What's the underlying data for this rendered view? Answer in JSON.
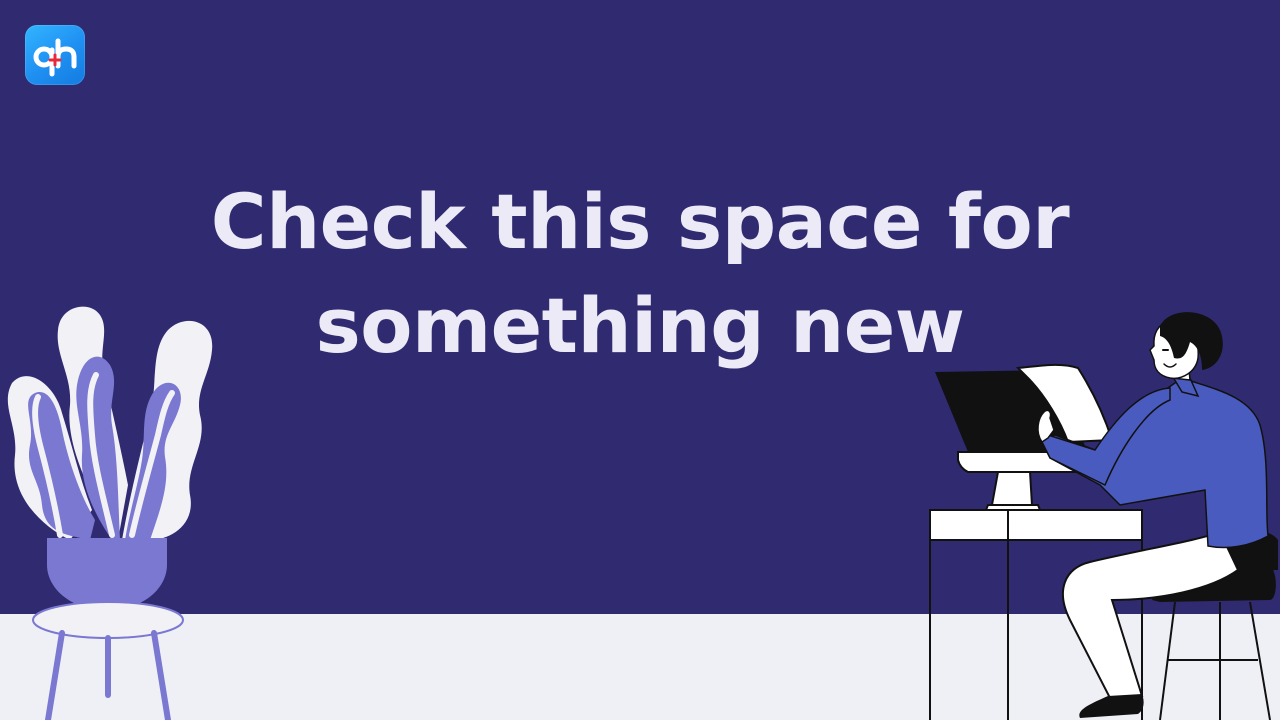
{
  "logo": {
    "text": "qh",
    "icon": "qh-logo",
    "background": "#1f8ff2",
    "accent": "#e8283b"
  },
  "headline": {
    "line1": "Check this space for",
    "line2": "something new"
  },
  "illustrations": {
    "plant": "potted-plant-illustration",
    "worker": "man-at-computer-illustration"
  },
  "colors": {
    "background": "#302a70",
    "floor": "#eff0f5",
    "text": "#eceaf6",
    "accent_purple": "#7a78d1",
    "shirt_blue": "#4a5bbf"
  }
}
